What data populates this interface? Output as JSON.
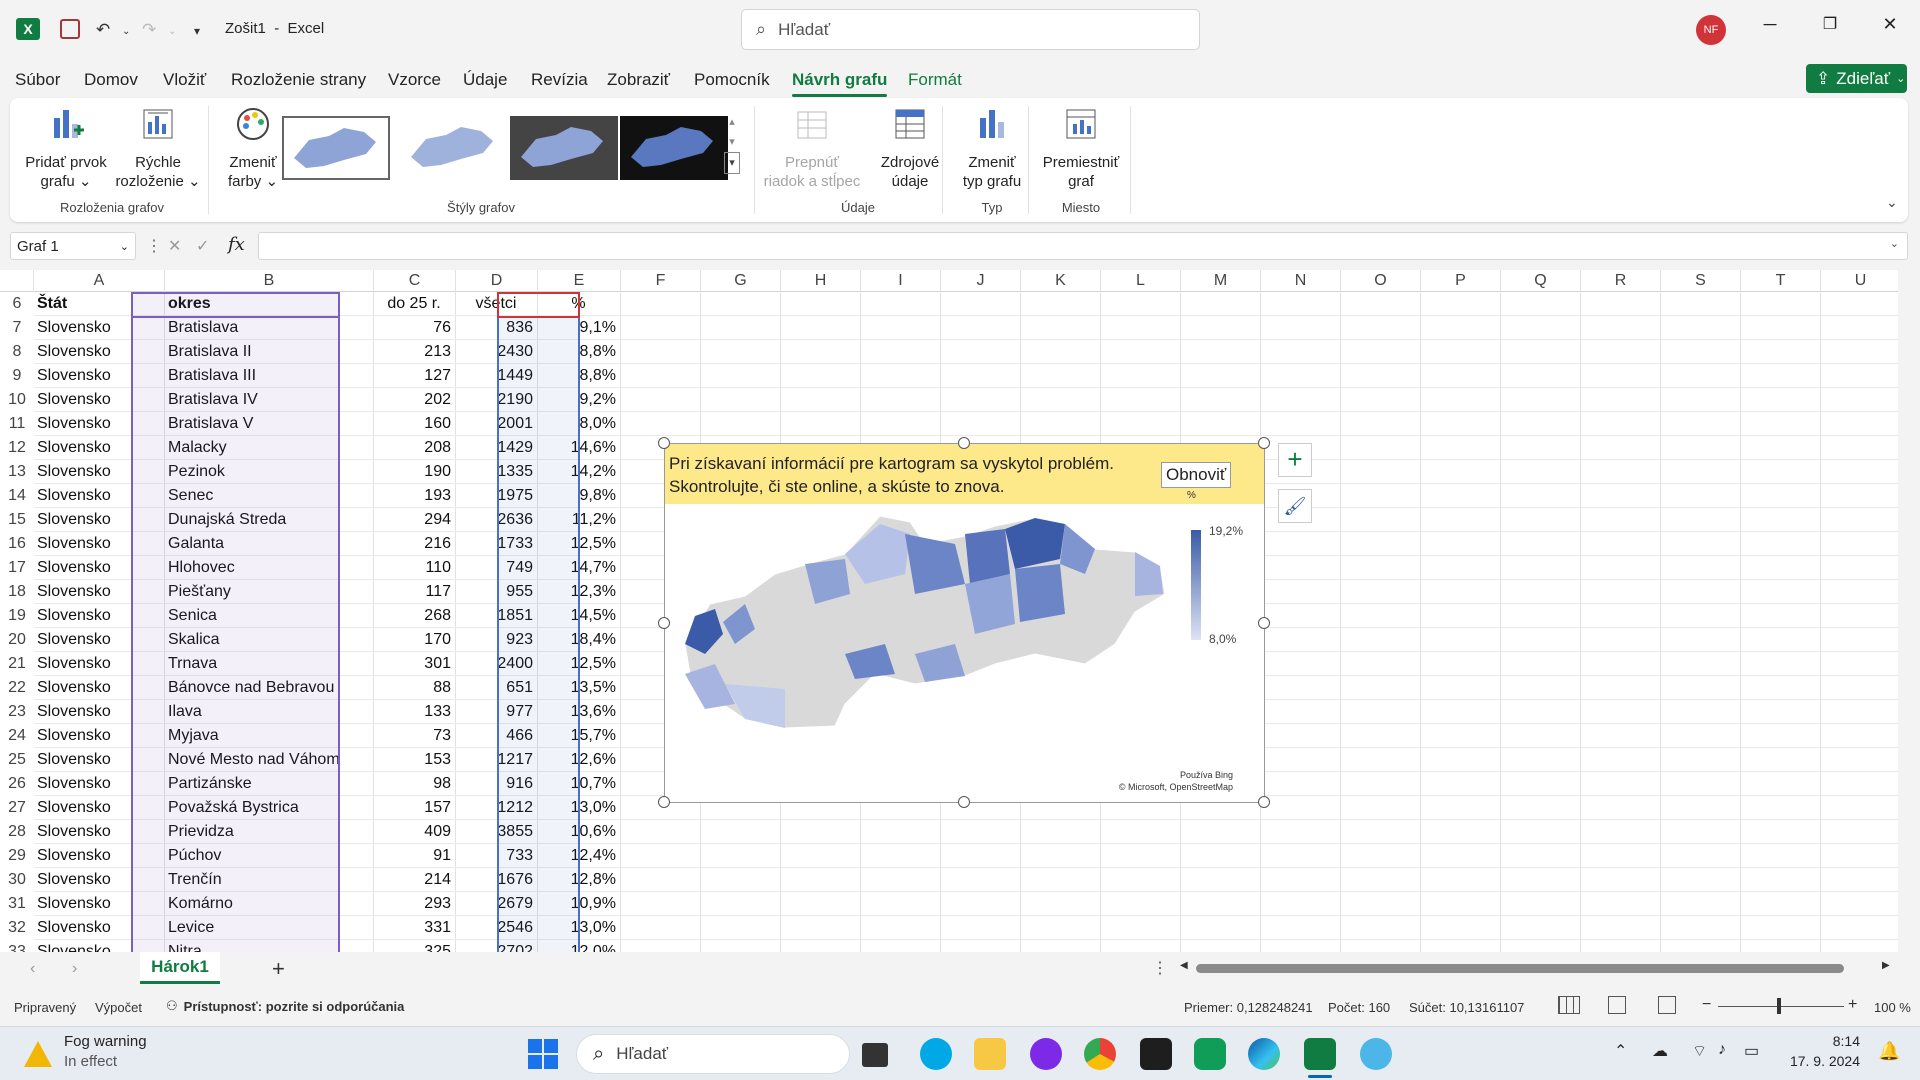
{
  "app": {
    "doc_title": "Zošit1",
    "separator": "-",
    "app_name": "Excel",
    "search_placeholder": "Hľadať",
    "avatar": "NF",
    "share_label": "Zdieľať"
  },
  "tabs": [
    "Súbor",
    "Domov",
    "Vložiť",
    "Rozloženie strany",
    "Vzorce",
    "Údaje",
    "Revízia",
    "Zobraziť",
    "Pomocník",
    "Návrh grafu",
    "Formát"
  ],
  "ribbon": {
    "add_element": [
      "Pridať prvok",
      "grafu"
    ],
    "quick_layout": [
      "Rýchle",
      "rozloženie"
    ],
    "change_colors": [
      "Zmeniť",
      "farby"
    ],
    "switch_rowcol": [
      "Prepnúť",
      "riadok a stĺpec"
    ],
    "source_data": [
      "Zdrojové",
      "údaje"
    ],
    "change_type": [
      "Zmeniť",
      "typ grafu"
    ],
    "move_chart": [
      "Premiestniť",
      "graf"
    ],
    "groups": [
      "Rozloženia grafov",
      "Štýly grafov",
      "Údaje",
      "Typ",
      "Miesto"
    ]
  },
  "formula": {
    "name_box": "Graf 1",
    "fx": "fx",
    "cancel": "✕",
    "enter": "✓"
  },
  "columns": [
    "A",
    "B",
    "C",
    "D",
    "E",
    "F",
    "G",
    "H",
    "I",
    "J",
    "K",
    "L",
    "M",
    "N",
    "O",
    "P",
    "Q",
    "R",
    "S",
    "T",
    "U"
  ],
  "header_row": {
    "num": "6",
    "a": "Štát",
    "b": "okres",
    "c": "do 25 r.",
    "d": "všetci",
    "e": "%"
  },
  "rows": [
    {
      "n": "7",
      "a": "Slovensko",
      "b": "Bratislava",
      "c": "76",
      "d": "836",
      "e": "9,1%"
    },
    {
      "n": "8",
      "a": "Slovensko",
      "b": "Bratislava II",
      "c": "213",
      "d": "2430",
      "e": "8,8%"
    },
    {
      "n": "9",
      "a": "Slovensko",
      "b": "Bratislava III",
      "c": "127",
      "d": "1449",
      "e": "8,8%"
    },
    {
      "n": "10",
      "a": "Slovensko",
      "b": "Bratislava IV",
      "c": "202",
      "d": "2190",
      "e": "9,2%"
    },
    {
      "n": "11",
      "a": "Slovensko",
      "b": "Bratislava V",
      "c": "160",
      "d": "2001",
      "e": "8,0%"
    },
    {
      "n": "12",
      "a": "Slovensko",
      "b": "Malacky",
      "c": "208",
      "d": "1429",
      "e": "14,6%"
    },
    {
      "n": "13",
      "a": "Slovensko",
      "b": "Pezinok",
      "c": "190",
      "d": "1335",
      "e": "14,2%"
    },
    {
      "n": "14",
      "a": "Slovensko",
      "b": "Senec",
      "c": "193",
      "d": "1975",
      "e": "9,8%"
    },
    {
      "n": "15",
      "a": "Slovensko",
      "b": "Dunajská Streda",
      "c": "294",
      "d": "2636",
      "e": "11,2%"
    },
    {
      "n": "16",
      "a": "Slovensko",
      "b": "Galanta",
      "c": "216",
      "d": "1733",
      "e": "12,5%"
    },
    {
      "n": "17",
      "a": "Slovensko",
      "b": "Hlohovec",
      "c": "110",
      "d": "749",
      "e": "14,7%"
    },
    {
      "n": "18",
      "a": "Slovensko",
      "b": "Piešťany",
      "c": "117",
      "d": "955",
      "e": "12,3%"
    },
    {
      "n": "19",
      "a": "Slovensko",
      "b": "Senica",
      "c": "268",
      "d": "1851",
      "e": "14,5%"
    },
    {
      "n": "20",
      "a": "Slovensko",
      "b": "Skalica",
      "c": "170",
      "d": "923",
      "e": "18,4%"
    },
    {
      "n": "21",
      "a": "Slovensko",
      "b": "Trnava",
      "c": "301",
      "d": "2400",
      "e": "12,5%"
    },
    {
      "n": "22",
      "a": "Slovensko",
      "b": "Bánovce nad Bebravou",
      "c": "88",
      "d": "651",
      "e": "13,5%"
    },
    {
      "n": "23",
      "a": "Slovensko",
      "b": "Ilava",
      "c": "133",
      "d": "977",
      "e": "13,6%"
    },
    {
      "n": "24",
      "a": "Slovensko",
      "b": "Myjava",
      "c": "73",
      "d": "466",
      "e": "15,7%"
    },
    {
      "n": "25",
      "a": "Slovensko",
      "b": "Nové Mesto nad Váhom",
      "c": "153",
      "d": "1217",
      "e": "12,6%"
    },
    {
      "n": "26",
      "a": "Slovensko",
      "b": "Partizánske",
      "c": "98",
      "d": "916",
      "e": "10,7%"
    },
    {
      "n": "27",
      "a": "Slovensko",
      "b": "Považská Bystrica",
      "c": "157",
      "d": "1212",
      "e": "13,0%"
    },
    {
      "n": "28",
      "a": "Slovensko",
      "b": "Prievidza",
      "c": "409",
      "d": "3855",
      "e": "10,6%"
    },
    {
      "n": "29",
      "a": "Slovensko",
      "b": "Púchov",
      "c": "91",
      "d": "733",
      "e": "12,4%"
    },
    {
      "n": "30",
      "a": "Slovensko",
      "b": "Trenčín",
      "c": "214",
      "d": "1676",
      "e": "12,8%"
    },
    {
      "n": "31",
      "a": "Slovensko",
      "b": "Komárno",
      "c": "293",
      "d": "2679",
      "e": "10,9%"
    },
    {
      "n": "32",
      "a": "Slovensko",
      "b": "Levice",
      "c": "331",
      "d": "2546",
      "e": "13,0%"
    },
    {
      "n": "33",
      "a": "Slovensko",
      "b": "Nitra",
      "c": "325",
      "d": "2702",
      "e": "12,0%"
    }
  ],
  "chart": {
    "warning_line1": "Pri získavaní informácií pre kartogram sa vyskytol problém.",
    "warning_line2": "Skontrolujte, či ste online, a skúste to znova.",
    "refresh_label": "Obnoviť",
    "legend_title": "%",
    "legend_max": "19,2%",
    "legend_min": "8,0%",
    "credit1": "Používa Bing",
    "credit2": "© Microsoft, OpenStreetMap",
    "color_high": "#3b5ba8",
    "color_low": "#d6dcf0"
  },
  "sheet": {
    "tab_name": "Hárok1",
    "add": "+"
  },
  "status": {
    "ready": "Pripravený",
    "calc": "Výpočet",
    "accessibility": "Prístupnosť: pozrite si odporúčania",
    "average": "Priemer: 0,128248241",
    "count": "Počet: 160",
    "sum": "Súčet: 10,13161107",
    "zoom": "100 %"
  },
  "taskbar": {
    "weather_title": "Fog warning",
    "weather_sub": "In effect",
    "search_placeholder": "Hľadať",
    "time": "8:14",
    "date": "17. 9. 2024"
  }
}
